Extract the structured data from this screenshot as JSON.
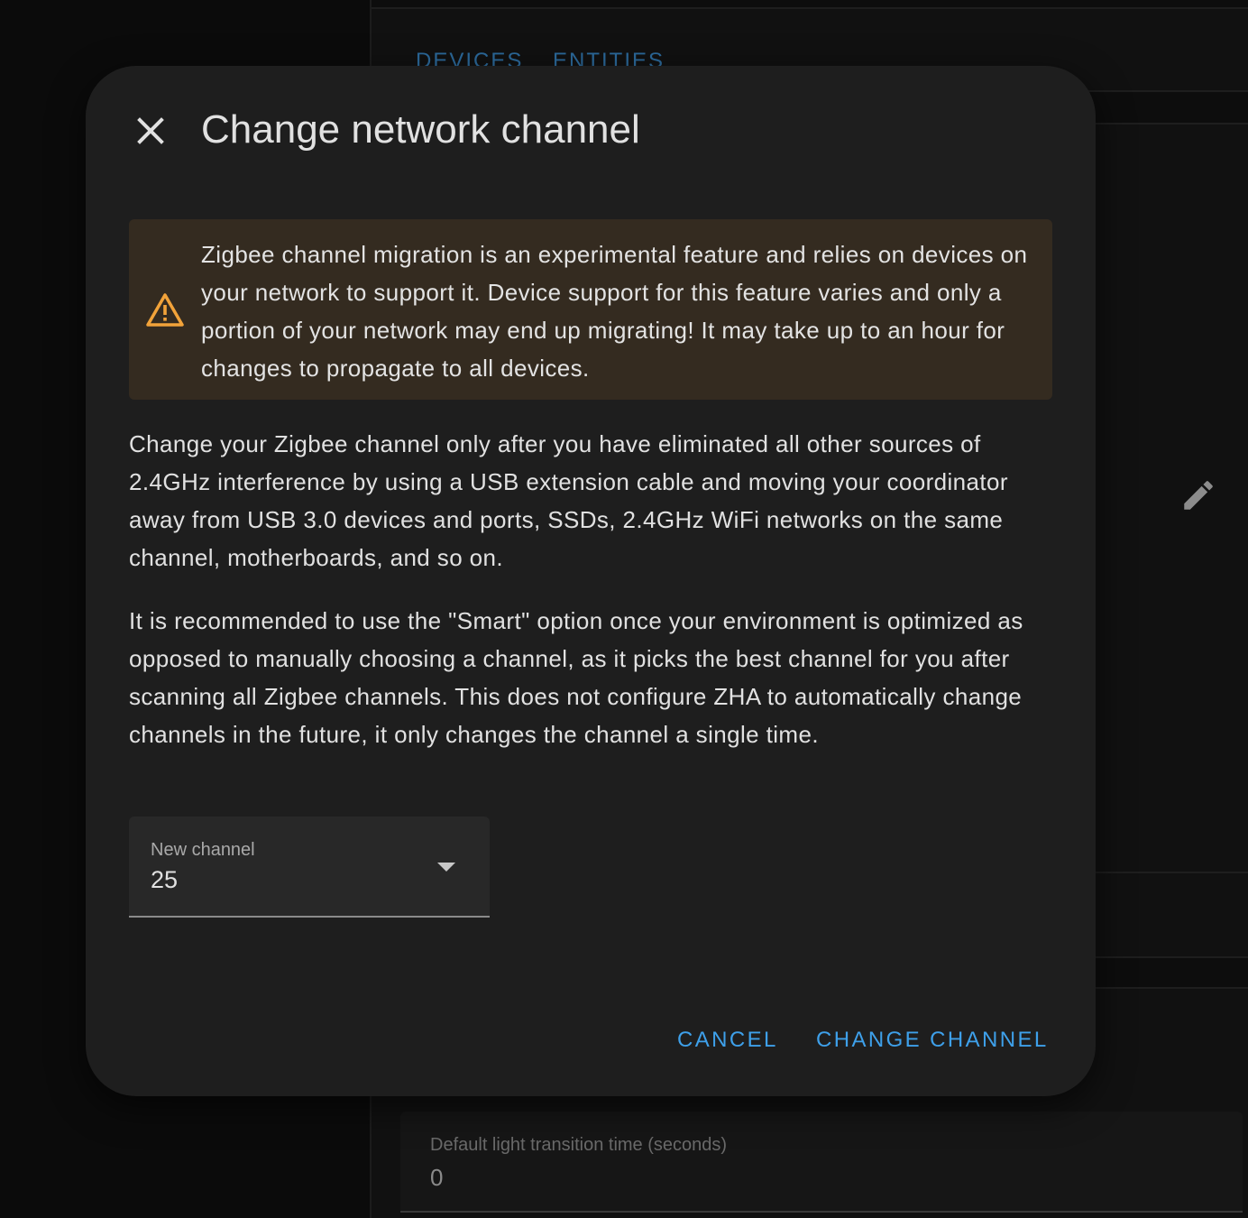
{
  "background": {
    "tabs": [
      {
        "label": "DEVICES"
      },
      {
        "label": "ENTITIES"
      }
    ],
    "edit_icon": "pencil-icon",
    "transition_field": {
      "label": "Default light transition time (seconds)",
      "value": "0"
    }
  },
  "dialog": {
    "title": "Change network channel",
    "close_icon": "close-icon",
    "warning": {
      "icon": "warning-icon",
      "text": "Zigbee channel migration is an experimental feature and relies on devices on your network to support it. Device support for this feature varies and only a portion of your network may end up migrating! It may take up to an hour for changes to propagate to all devices."
    },
    "paragraph1": "Change your Zigbee channel only after you have eliminated all other sources of 2.4GHz interference by using a USB extension cable and moving your coordinator away from USB 3.0 devices and ports, SSDs, 2.4GHz WiFi networks on the same channel, motherboards, and so on.",
    "paragraph2": "It is recommended to use the \"Smart\" option once your environment is optimized as opposed to manually choosing a channel, as it picks the best channel for you after scanning all Zigbee channels. This does not configure ZHA to automatically change channels in the future, it only changes the channel a single time.",
    "channel_select": {
      "label": "New channel",
      "value": "25"
    },
    "buttons": {
      "cancel": "CANCEL",
      "change": "CHANGE CHANNEL"
    }
  },
  "colors": {
    "accent": "#3ea0ea",
    "warning": "#f2a33a",
    "dialog_bg": "#1e1e1e",
    "warning_bg": "#342b20"
  }
}
